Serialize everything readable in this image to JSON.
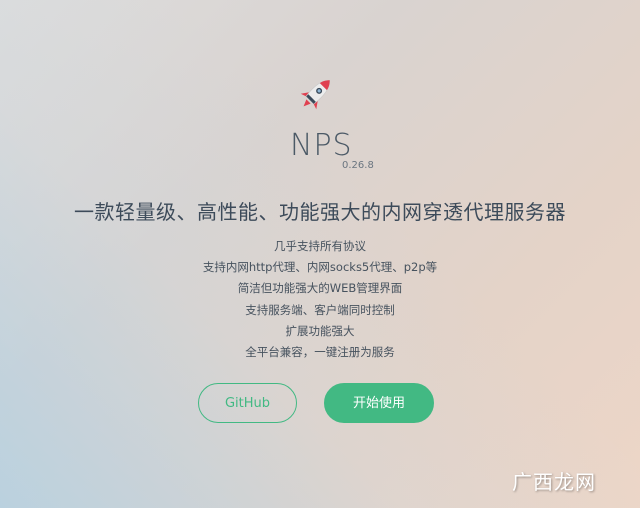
{
  "app": {
    "title": "NPS",
    "version": "0.26.8",
    "tagline": "一款轻量级、高性能、功能强大的内网穿透代理服务器"
  },
  "features": [
    "几乎支持所有协议",
    "支持内网http代理、内网socks5代理、p2p等",
    "简洁但功能强大的WEB管理界面",
    "支持服务端、客户端同时控制",
    "扩展功能强大",
    "全平台兼容，一键注册为服务"
  ],
  "buttons": {
    "github_label": "GitHub",
    "start_label": "开始使用"
  },
  "watermark": {
    "text": "广西龙网"
  },
  "colors": {
    "accent": "#42b983",
    "text": "#34495e",
    "rocket_red": "#e04050"
  },
  "icons": {
    "logo": "rocket-icon"
  }
}
